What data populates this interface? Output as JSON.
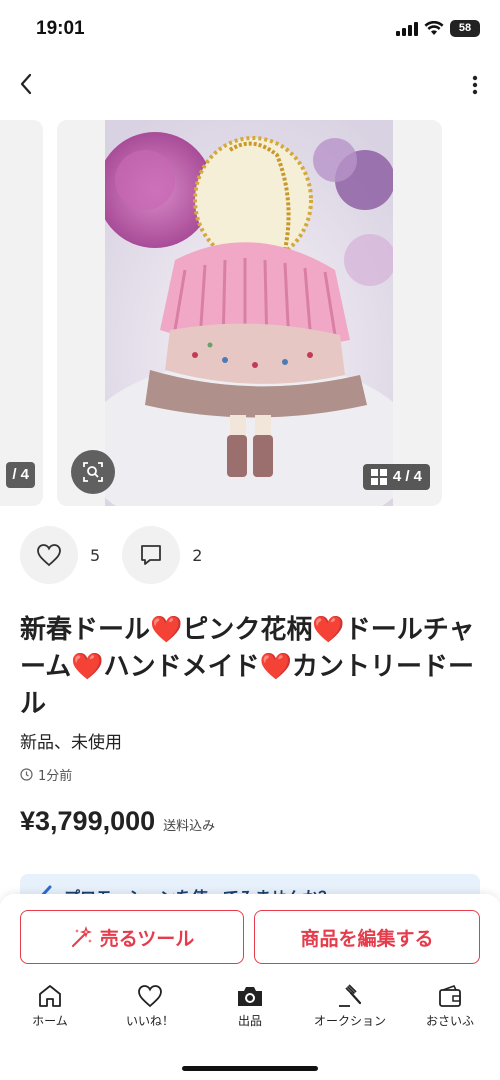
{
  "status": {
    "time": "19:01",
    "battery": "58"
  },
  "gallery": {
    "prev_counter": "/ 4",
    "counter": "4 / 4"
  },
  "reactions": {
    "likes": "5",
    "comments": "2"
  },
  "item": {
    "title": "新春ドール❤️ピンク花柄❤️ドールチャーム❤️ハンドメイド❤️カントリードール",
    "condition": "新品、未使用",
    "posted": "1分前",
    "price": "¥3,799,000",
    "shipping": "送料込み"
  },
  "promo": {
    "text": "プロモーションを使ってみませんか？"
  },
  "actions": {
    "sell_tool": "売るツール",
    "edit_item": "商品を編集する"
  },
  "tabs": [
    {
      "label": "ホーム",
      "icon": "home-icon"
    },
    {
      "label": "いいね！",
      "icon": "heart-icon"
    },
    {
      "label": "出品",
      "icon": "camera-icon"
    },
    {
      "label": "オークション",
      "icon": "gavel-icon"
    },
    {
      "label": "おさいふ",
      "icon": "wallet-icon"
    }
  ],
  "colors": {
    "accent": "#e43c4b",
    "promo_bg": "#e7f1fb"
  }
}
